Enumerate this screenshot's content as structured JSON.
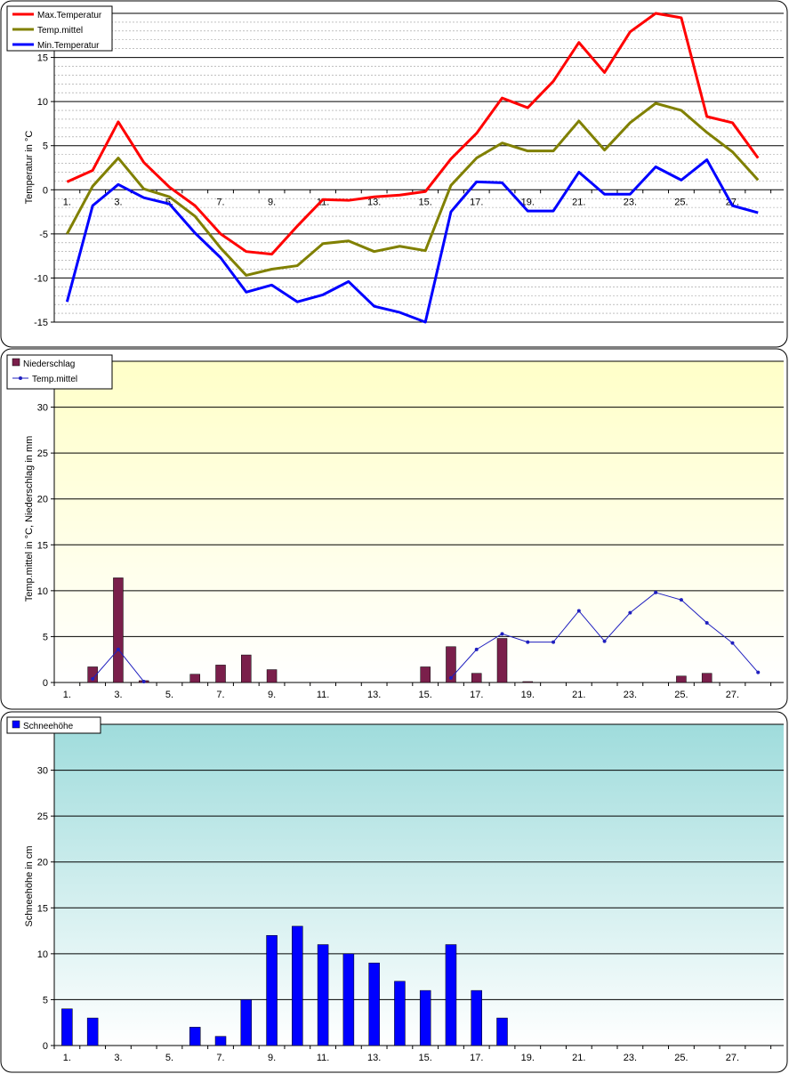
{
  "chart_data": [
    {
      "type": "line",
      "ylabel": "Temperatur  in °C",
      "ylim": [
        -15,
        20
      ],
      "yticks": [
        -15,
        -10,
        -5,
        0,
        5,
        10,
        15
      ],
      "xticks": [
        "1.",
        "3.",
        "5.",
        "7.",
        "9.",
        "11.",
        "13.",
        "15.",
        "17.",
        "19.",
        "21.",
        "23.",
        "25.",
        "27."
      ],
      "grid": true,
      "legend": "top-left",
      "x": [
        1,
        2,
        3,
        4,
        5,
        6,
        7,
        8,
        9,
        10,
        11,
        12,
        13,
        14,
        15,
        16,
        17,
        18,
        19,
        20,
        21,
        22,
        23,
        24,
        25,
        26,
        27,
        28
      ],
      "series": [
        {
          "name": "Max.Temperatur",
          "color": "#ff0000",
          "values": [
            0.9,
            2.2,
            7.7,
            3.1,
            0.3,
            -1.8,
            -5.0,
            -7.0,
            -7.3,
            -4.1,
            -1.1,
            -1.2,
            -0.8,
            -0.6,
            -0.2,
            3.5,
            6.4,
            10.4,
            9.3,
            12.3,
            16.7,
            13.3,
            17.9,
            20.0,
            19.5,
            8.3,
            7.6,
            3.6
          ]
        },
        {
          "name": "Temp.mittel",
          "color": "#808000",
          "values": [
            -5.0,
            0.4,
            3.6,
            0.1,
            -0.8,
            -3.0,
            -6.6,
            -9.7,
            -9.0,
            -8.6,
            -6.1,
            -5.8,
            -7.0,
            -6.4,
            -6.9,
            0.5,
            3.6,
            5.3,
            4.4,
            4.4,
            7.8,
            4.5,
            7.6,
            9.8,
            9.0,
            6.5,
            4.3,
            1.1
          ]
        },
        {
          "name": "Min.Temperatur",
          "color": "#0000ff",
          "values": [
            -12.7,
            -1.8,
            0.6,
            -0.9,
            -1.6,
            -4.9,
            -7.7,
            -11.6,
            -10.8,
            -12.7,
            -11.9,
            -10.4,
            -13.2,
            -13.9,
            -17.5,
            -2.5,
            0.9,
            0.8,
            -2.4,
            -2.4,
            2.0,
            -0.5,
            -0.5,
            2.6,
            1.1,
            3.4,
            -1.8,
            -2.6
          ]
        }
      ]
    },
    {
      "type": "bar",
      "ylabel": "Temp.mittel  in °C, Niederschlag in mm",
      "ylim": [
        0,
        35
      ],
      "yticks": [
        0,
        5,
        10,
        15,
        20,
        25,
        30
      ],
      "xticks": [
        "1.",
        "3.",
        "5.",
        "7.",
        "9.",
        "11.",
        "13.",
        "15.",
        "17.",
        "19.",
        "21.",
        "23.",
        "25.",
        "27."
      ],
      "grid": true,
      "legend": "top-left",
      "x": [
        1,
        2,
        3,
        4,
        5,
        6,
        7,
        8,
        9,
        10,
        11,
        12,
        13,
        14,
        15,
        16,
        17,
        18,
        19,
        20,
        21,
        22,
        23,
        24,
        25,
        26,
        27,
        28
      ],
      "series": [
        {
          "name": "Niederschlag",
          "type": "bar",
          "color": "#7a1f4b",
          "values": [
            0,
            1.7,
            11.4,
            0.2,
            0,
            0.9,
            1.9,
            3.0,
            1.4,
            0,
            0,
            0,
            0,
            0,
            1.7,
            3.9,
            1.0,
            4.8,
            0.1,
            0,
            0,
            0,
            0,
            0,
            0.7,
            1.0,
            0,
            0
          ]
        },
        {
          "name": "Temp.mittel",
          "type": "line",
          "color": "#1f1fbf",
          "values": [
            null,
            0.4,
            3.6,
            0.1,
            null,
            null,
            null,
            null,
            null,
            null,
            null,
            null,
            null,
            null,
            null,
            0.5,
            3.6,
            5.3,
            4.4,
            4.4,
            7.8,
            4.5,
            7.6,
            9.8,
            9.0,
            6.5,
            4.3,
            1.1
          ]
        }
      ]
    },
    {
      "type": "bar",
      "ylabel": "Schneehöhe in cm",
      "ylim": [
        0,
        35
      ],
      "yticks": [
        0,
        5,
        10,
        15,
        20,
        25,
        30
      ],
      "xticks": [
        "1.",
        "3.",
        "5.",
        "7.",
        "9.",
        "11.",
        "13.",
        "15.",
        "17.",
        "19.",
        "21.",
        "23.",
        "25.",
        "27."
      ],
      "grid": true,
      "legend": "top-left",
      "x": [
        1,
        2,
        3,
        4,
        5,
        6,
        7,
        8,
        9,
        10,
        11,
        12,
        13,
        14,
        15,
        16,
        17,
        18,
        19,
        20,
        21,
        22,
        23,
        24,
        25,
        26,
        27,
        28
      ],
      "series": [
        {
          "name": "Schneehöhe",
          "color": "#0000ff",
          "values": [
            4,
            3,
            0,
            0,
            0,
            2,
            1,
            5,
            12,
            13,
            11,
            10,
            9,
            7,
            6,
            11,
            6,
            3,
            0,
            0,
            0,
            0,
            0,
            0,
            0,
            0,
            0,
            0
          ]
        }
      ]
    }
  ]
}
